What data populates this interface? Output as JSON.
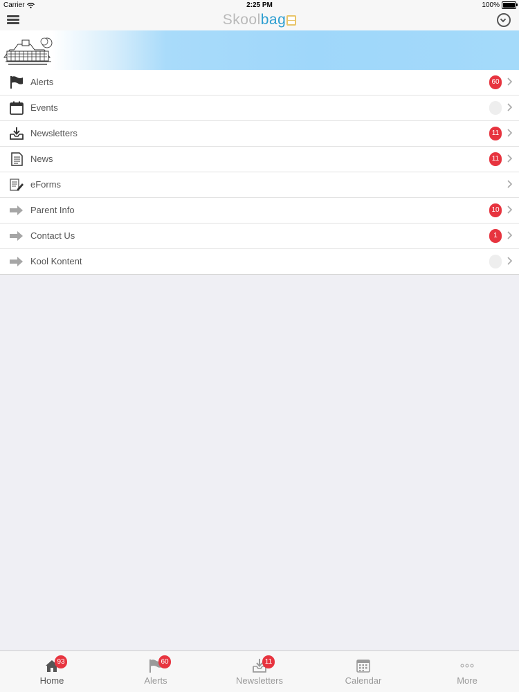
{
  "status_bar": {
    "carrier": "Carrier",
    "time": "2:25 PM",
    "battery": "100%"
  },
  "nav": {
    "logo_part1": "Skool",
    "logo_part2": "bag",
    "colors": {
      "logo_grey": "#b9b9b9",
      "logo_blue": "#2d9ed0",
      "badge_red": "#e7343f"
    }
  },
  "menu": {
    "items": [
      {
        "label": "Alerts",
        "icon": "flag-icon",
        "badge": "60"
      },
      {
        "label": "Events",
        "icon": "calendar-icon",
        "badge": ""
      },
      {
        "label": "Newsletters",
        "icon": "inbox-download-icon",
        "badge": "11"
      },
      {
        "label": "News",
        "icon": "document-icon",
        "badge": "11"
      },
      {
        "label": "eForms",
        "icon": "form-edit-icon"
      },
      {
        "label": "Parent Info",
        "icon": "arrow-right-icon",
        "badge": "10"
      },
      {
        "label": "Contact Us",
        "icon": "arrow-right-icon",
        "badge": "1"
      },
      {
        "label": "Kool Kontent",
        "icon": "arrow-right-icon",
        "badge": ""
      }
    ]
  },
  "tabbar": {
    "tabs": [
      {
        "label": "Home",
        "icon": "home-icon",
        "badge": "93",
        "active": true
      },
      {
        "label": "Alerts",
        "icon": "flag-icon",
        "badge": "60"
      },
      {
        "label": "Newsletters",
        "icon": "inbox-download-icon",
        "badge": "11"
      },
      {
        "label": "Calendar",
        "icon": "calendar-icon"
      },
      {
        "label": "More",
        "icon": "more-dots-icon"
      }
    ]
  }
}
